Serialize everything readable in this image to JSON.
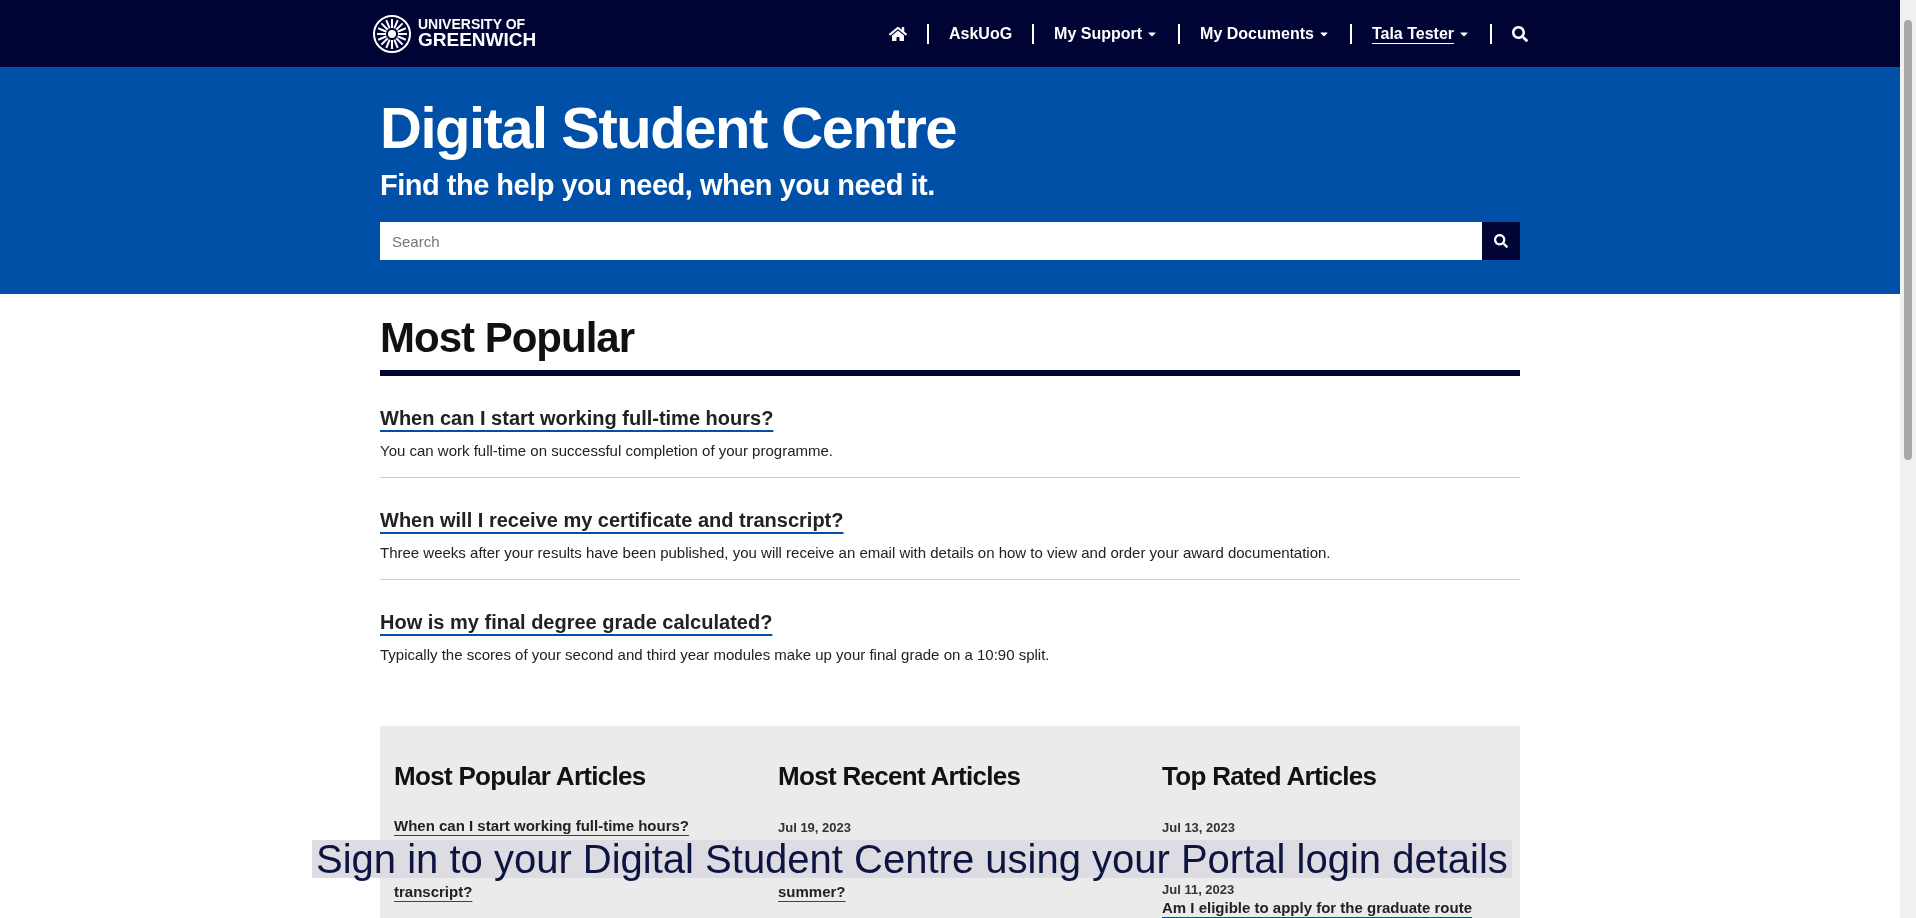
{
  "nav": {
    "logo_line1": "UNIVERSITY OF",
    "logo_line2": "GREENWICH",
    "items": [
      {
        "label": "AskUoG",
        "dropdown": false,
        "hovered": false
      },
      {
        "label": "My Support",
        "dropdown": true,
        "hovered": false
      },
      {
        "label": "My Documents",
        "dropdown": true,
        "hovered": false
      },
      {
        "label": "Tala Tester",
        "dropdown": true,
        "hovered": true
      }
    ]
  },
  "hero": {
    "title": "Digital Student Centre",
    "subtitle": "Find the help you need, when you need it.",
    "search": {
      "placeholder": "Search"
    }
  },
  "most_popular": {
    "heading": "Most Popular",
    "items": [
      {
        "title": "When can I start working full-time hours?",
        "summary": "You can work full-time on successful completion of your programme."
      },
      {
        "title": "When will I receive my certificate and transcript?",
        "summary": "Three weeks after your results have been published, you will receive an email with details on how to view and order your award documentation."
      },
      {
        "title": "How is my final degree grade calculated?",
        "summary": "Typically the scores of your second and third year modules make up your final grade on a 10:90 split."
      }
    ]
  },
  "article_columns": [
    {
      "heading": "Most Popular Articles",
      "before_caption": [
        {
          "kind": "link",
          "text": "When can I start working full-time hours?"
        }
      ],
      "after_caption": [
        {
          "kind": "link",
          "text": "transcript?"
        }
      ]
    },
    {
      "heading": "Most Recent Articles",
      "before_caption": [
        {
          "kind": "date",
          "text": "Jul 19, 2023"
        }
      ],
      "after_caption": [
        {
          "kind": "link",
          "text": "summer?"
        }
      ]
    },
    {
      "heading": "Top Rated Articles",
      "before_caption": [
        {
          "kind": "date",
          "text": "Jul 13, 2023"
        }
      ],
      "after_caption": [
        {
          "kind": "date",
          "text": "Jul 11, 2023"
        },
        {
          "kind": "link",
          "text": "Am I eligible to apply for the graduate route"
        }
      ]
    }
  ],
  "caption": "Sign in to your Digital Student Centre using your Portal login details"
}
